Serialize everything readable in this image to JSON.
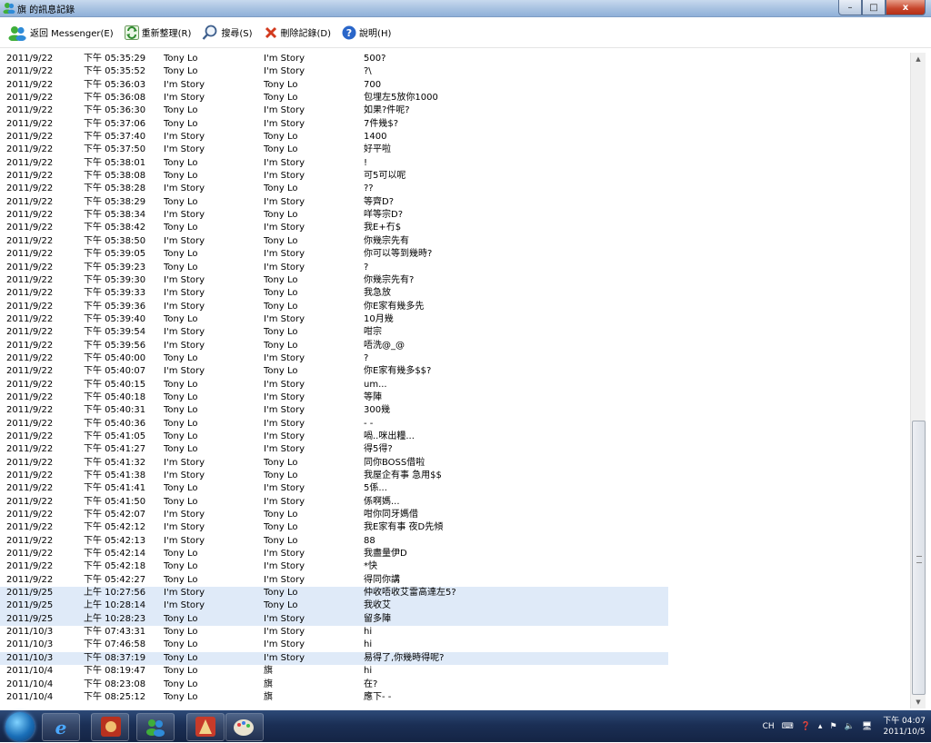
{
  "window": {
    "title": "旗 的訊息記錄",
    "min": "–",
    "max": "□",
    "close": "x"
  },
  "toolbar": {
    "back": "返回 Messenger(E)",
    "refresh": "重新整理(R)",
    "search": "搜尋(S)",
    "delete": "刪除記錄(D)",
    "help": "說明(H)"
  },
  "rows": [
    [
      "2011/9/22",
      "下午 05:35:29",
      "Tony Lo",
      "I'm Story",
      "500?"
    ],
    [
      "2011/9/22",
      "下午 05:35:52",
      "Tony Lo",
      "I'm Story",
      "?\\"
    ],
    [
      "2011/9/22",
      "下午 05:36:03",
      "I'm Story",
      "Tony Lo",
      "700"
    ],
    [
      "2011/9/22",
      "下午 05:36:08",
      "I'm Story",
      "Tony Lo",
      "包埋左5放你1000"
    ],
    [
      "2011/9/22",
      "下午 05:36:30",
      "Tony Lo",
      "I'm Story",
      "如果?件呢?"
    ],
    [
      "2011/9/22",
      "下午 05:37:06",
      "Tony Lo",
      "I'm Story",
      "7件幾$?"
    ],
    [
      "2011/9/22",
      "下午 05:37:40",
      "I'm Story",
      "Tony Lo",
      "1400"
    ],
    [
      "2011/9/22",
      "下午 05:37:50",
      "I'm Story",
      "Tony Lo",
      "好平啦"
    ],
    [
      "2011/9/22",
      "下午 05:38:01",
      "Tony Lo",
      "I'm Story",
      "!"
    ],
    [
      "2011/9/22",
      "下午 05:38:08",
      "Tony Lo",
      "I'm Story",
      "可5可以呢"
    ],
    [
      "2011/9/22",
      "下午 05:38:28",
      "I'm Story",
      "Tony Lo",
      "??"
    ],
    [
      "2011/9/22",
      "下午 05:38:29",
      "Tony Lo",
      "I'm Story",
      "等齊D?"
    ],
    [
      "2011/9/22",
      "下午 05:38:34",
      "I'm Story",
      "Tony Lo",
      "咩等宗D?"
    ],
    [
      "2011/9/22",
      "下午 05:38:42",
      "Tony Lo",
      "I'm Story",
      "我E+冇$"
    ],
    [
      "2011/9/22",
      "下午 05:38:50",
      "I'm Story",
      "Tony Lo",
      "你幾宗先有"
    ],
    [
      "2011/9/22",
      "下午 05:39:05",
      "Tony Lo",
      "I'm Story",
      "你可以等到幾時?"
    ],
    [
      "2011/9/22",
      "下午 05:39:23",
      "Tony Lo",
      "I'm Story",
      "?"
    ],
    [
      "2011/9/22",
      "下午 05:39:30",
      "I'm Story",
      "Tony Lo",
      "你幾宗先有?"
    ],
    [
      "2011/9/22",
      "下午 05:39:33",
      "I'm Story",
      "Tony Lo",
      "我急放"
    ],
    [
      "2011/9/22",
      "下午 05:39:36",
      "I'm Story",
      "Tony Lo",
      "你E家有幾多先"
    ],
    [
      "2011/9/22",
      "下午 05:39:40",
      "Tony Lo",
      "I'm Story",
      "10月幾"
    ],
    [
      "2011/9/22",
      "下午 05:39:54",
      "I'm Story",
      "Tony Lo",
      "咁宗"
    ],
    [
      "2011/9/22",
      "下午 05:39:56",
      "I'm Story",
      "Tony Lo",
      "唔洗@_@"
    ],
    [
      "2011/9/22",
      "下午 05:40:00",
      "Tony Lo",
      "I'm Story",
      "?"
    ],
    [
      "2011/9/22",
      "下午 05:40:07",
      "I'm Story",
      "Tony Lo",
      "你E家有幾多$$?"
    ],
    [
      "2011/9/22",
      "下午 05:40:15",
      "Tony Lo",
      "I'm Story",
      "um..."
    ],
    [
      "2011/9/22",
      "下午 05:40:18",
      "Tony Lo",
      "I'm Story",
      "等陣"
    ],
    [
      "2011/9/22",
      "下午 05:40:31",
      "Tony Lo",
      "I'm Story",
      "300幾"
    ],
    [
      "2011/9/22",
      "下午 05:40:36",
      "Tony Lo",
      "I'm Story",
      "- -"
    ],
    [
      "2011/9/22",
      "下午 05:41:05",
      "Tony Lo",
      "I'm Story",
      "喎..咪出糧..."
    ],
    [
      "2011/9/22",
      "下午 05:41:27",
      "Tony Lo",
      "I'm Story",
      "得5得?"
    ],
    [
      "2011/9/22",
      "下午 05:41:32",
      "I'm Story",
      "Tony Lo",
      "同你BOSS借啦"
    ],
    [
      "2011/9/22",
      "下午 05:41:38",
      "I'm Story",
      "Tony Lo",
      "我屋企有事 急用$$"
    ],
    [
      "2011/9/22",
      "下午 05:41:41",
      "Tony Lo",
      "I'm Story",
      "5係..."
    ],
    [
      "2011/9/22",
      "下午 05:41:50",
      "Tony Lo",
      "I'm Story",
      "係啊媽..."
    ],
    [
      "2011/9/22",
      "下午 05:42:07",
      "I'm Story",
      "Tony Lo",
      "咁你同牙媽借"
    ],
    [
      "2011/9/22",
      "下午 05:42:12",
      "I'm Story",
      "Tony Lo",
      "我E家有事 夜D先傾"
    ],
    [
      "2011/9/22",
      "下午 05:42:13",
      "I'm Story",
      "Tony Lo",
      "88"
    ],
    [
      "2011/9/22",
      "下午 05:42:14",
      "Tony Lo",
      "I'm Story",
      "我盡量伊D"
    ],
    [
      "2011/9/22",
      "下午 05:42:18",
      "Tony Lo",
      "I'm Story",
      "*快"
    ],
    [
      "2011/9/22",
      "下午 05:42:27",
      "Tony Lo",
      "I'm Story",
      "得同你講"
    ],
    [
      "2011/9/25",
      "上午 10:27:56",
      "I'm Story",
      "Tony Lo",
      "仲收唔收艾雷高達左5?"
    ],
    [
      "2011/9/25",
      "上午 10:28:14",
      "I'm Story",
      "Tony Lo",
      "我收艾"
    ],
    [
      "2011/9/25",
      "上午 10:28:23",
      "Tony Lo",
      "I'm Story",
      "留多陣"
    ],
    [
      "2011/10/3",
      "下午 07:43:31",
      "Tony Lo",
      "I'm Story",
      "hi"
    ],
    [
      "2011/10/3",
      "下午 07:46:58",
      "Tony Lo",
      "I'm Story",
      "hi"
    ],
    [
      "2011/10/3",
      "下午 08:37:19",
      "Tony Lo",
      "I'm Story",
      "易得了,你幾時得呢?"
    ],
    [
      "2011/10/4",
      "下午 08:19:47",
      "Tony Lo",
      "旗",
      "hi"
    ],
    [
      "2011/10/4",
      "下午 08:23:08",
      "Tony Lo",
      "旗",
      "在?"
    ],
    [
      "2011/10/4",
      "下午 08:25:12",
      "Tony Lo",
      "旗",
      "應下- -"
    ]
  ],
  "highlighted_rows": [
    41,
    42,
    43,
    46
  ],
  "tray": {
    "lang": "CH",
    "time": "下午 04:07",
    "date": "2011/10/5"
  },
  "colors": {
    "highlight": "#dfeaf8",
    "titlebar": "#a9c3e2",
    "taskbar": "#1b2f55"
  }
}
